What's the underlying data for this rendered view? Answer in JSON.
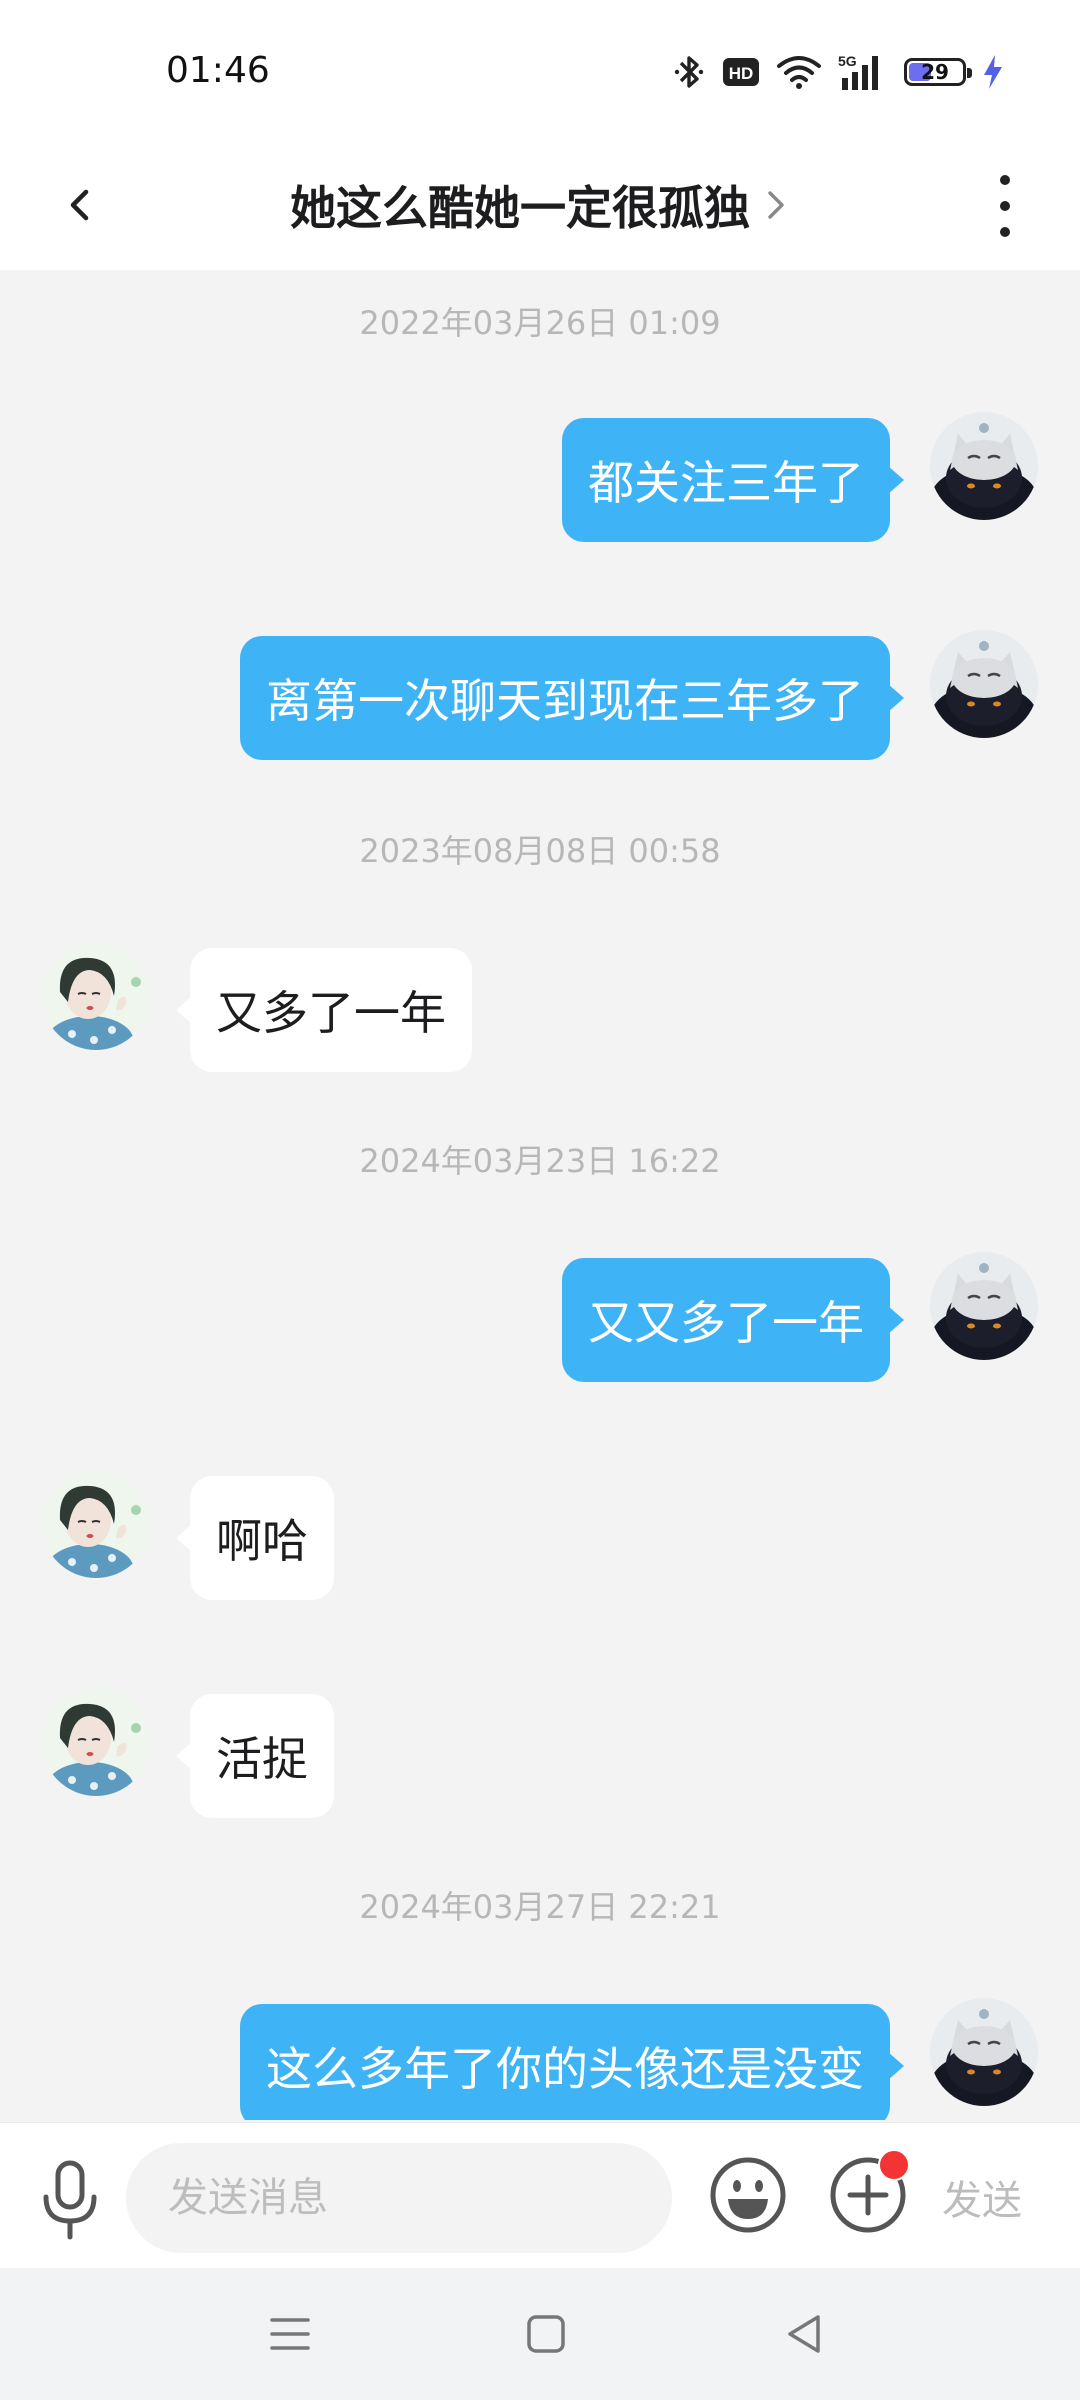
{
  "status_bar": {
    "time": "01:46",
    "hd_label": "HD",
    "network_label": "5G",
    "battery_level": "29",
    "icons": [
      "bluetooth-icon",
      "hd-icon",
      "wifi-icon",
      "signal-5g-icon",
      "battery-icon",
      "charging-icon"
    ]
  },
  "header": {
    "title": "她这么酷她一定很孤独",
    "back_icon": "chevron-left-icon",
    "more_icon": "vertical-dots-icon"
  },
  "messages": [
    {
      "type": "timestamp",
      "text": "2022年03月26日 01:09"
    },
    {
      "type": "message",
      "direction": "outgoing",
      "text": "都关注三年了"
    },
    {
      "type": "message",
      "direction": "outgoing",
      "text": "离第一次聊天到现在三年多了"
    },
    {
      "type": "timestamp",
      "text": "2023年08月08日 00:58"
    },
    {
      "type": "message",
      "direction": "incoming",
      "text": "又多了一年"
    },
    {
      "type": "timestamp",
      "text": "2024年03月23日 16:22"
    },
    {
      "type": "message",
      "direction": "outgoing",
      "text": "又又多了一年"
    },
    {
      "type": "message",
      "direction": "incoming",
      "text": "啊哈"
    },
    {
      "type": "message",
      "direction": "incoming",
      "text": "活捉"
    },
    {
      "type": "timestamp",
      "text": "2024年03月27日 22:21"
    },
    {
      "type": "message",
      "direction": "outgoing",
      "text": "这么多年了你的头像还是没变"
    }
  ],
  "input_bar": {
    "placeholder": "发送消息",
    "value": "",
    "send_label": "发送",
    "icons": [
      "microphone-icon",
      "emoji-icon",
      "plus-icon"
    ]
  },
  "nav_bar": {
    "icons": [
      "menu-icon",
      "home-icon",
      "back-triangle-icon"
    ]
  },
  "colors": {
    "outgoing_bubble": "#3eb4f6",
    "incoming_bubble": "#ffffff",
    "chat_background": "#f3f3f3",
    "notification_dot": "#f23434"
  }
}
